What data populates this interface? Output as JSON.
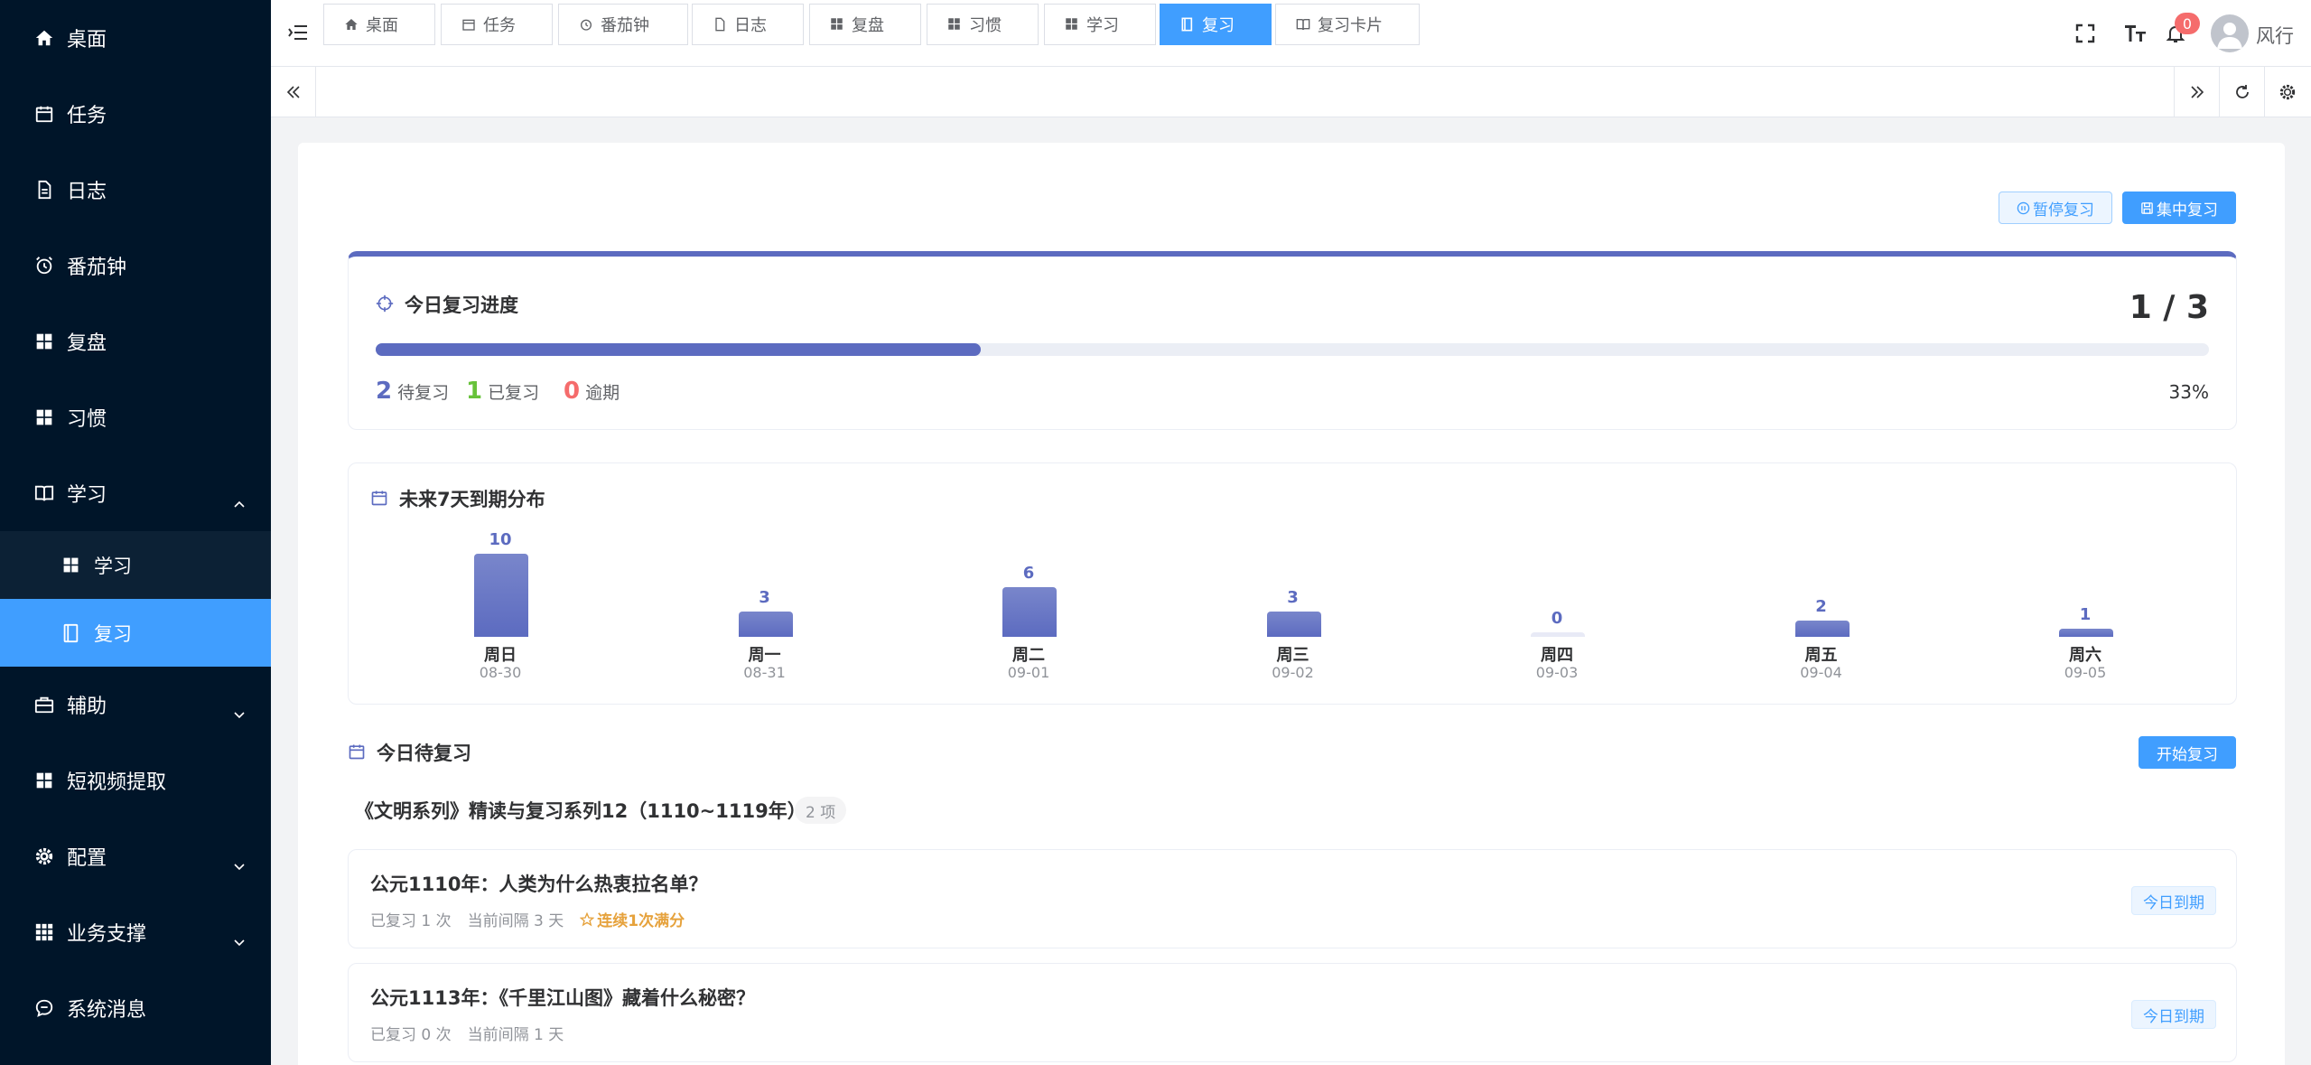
{
  "sidebar": {
    "items": [
      {
        "label": "桌面",
        "icon": "home-icon"
      },
      {
        "label": "任务",
        "icon": "calendar-icon"
      },
      {
        "label": "日志",
        "icon": "document-icon"
      },
      {
        "label": "番茄钟",
        "icon": "alarm-clock-icon"
      },
      {
        "label": "复盘",
        "icon": "grid-icon"
      },
      {
        "label": "习惯",
        "icon": "grid-icon"
      },
      {
        "label": "学习",
        "icon": "book-icon",
        "expanded": true
      },
      {
        "label": "辅助",
        "icon": "toolbox-icon"
      },
      {
        "label": "短视频提取",
        "icon": "grid-icon"
      },
      {
        "label": "配置",
        "icon": "gear-icon"
      },
      {
        "label": "业务支撑",
        "icon": "apps-icon"
      },
      {
        "label": "系统消息",
        "icon": "chat-icon"
      }
    ],
    "sub_items": [
      {
        "label": "学习",
        "icon": "grid-icon"
      },
      {
        "label": "复习",
        "icon": "notebook-icon",
        "active": true
      }
    ]
  },
  "header": {
    "breadcrumb": [
      "学习",
      "/",
      "复习"
    ],
    "notification_count": "0",
    "user_name": "风行"
  },
  "tags": [
    {
      "label": "桌面",
      "icon": "home-icon"
    },
    {
      "label": "任务",
      "icon": "calendar-icon"
    },
    {
      "label": "番茄钟",
      "icon": "alarm-clock-icon"
    },
    {
      "label": "日志",
      "icon": "document-icon"
    },
    {
      "label": "复盘",
      "icon": "grid-icon"
    },
    {
      "label": "习惯",
      "icon": "grid-icon"
    },
    {
      "label": "学习",
      "icon": "grid-icon"
    },
    {
      "label": "复习",
      "icon": "notebook-icon",
      "active": true
    },
    {
      "label": "复习卡片",
      "icon": "book-icon"
    }
  ],
  "toolbar": {
    "pause_label": "暂停复习",
    "focus_label": "集中复习"
  },
  "progress": {
    "title": "今日复习进度",
    "count_text": "1 / 3",
    "fraction": 0.33,
    "pending_num": "2",
    "pending_label": "待复习",
    "done_num": "1",
    "done_label": "已复习",
    "overdue_num": "0",
    "overdue_label": "逾期",
    "percent_text": "33%",
    "colors": {
      "accent": "#5c6bc0",
      "done": "#67c23a",
      "overdue": "#f56c6c"
    }
  },
  "chart_data": {
    "type": "bar",
    "title": "未来7天到期分布",
    "categories": [
      "周日",
      "周一",
      "周二",
      "周三",
      "周四",
      "周五",
      "周六"
    ],
    "dates": [
      "08-30",
      "08-31",
      "09-01",
      "09-02",
      "09-03",
      "09-04",
      "09-05"
    ],
    "values": [
      10,
      3,
      6,
      3,
      0,
      2,
      1
    ],
    "ylim": [
      0,
      10
    ],
    "color": "#5c6bc0"
  },
  "today": {
    "title": "今日待复习",
    "start_label": "开始复习",
    "group_title": "《文明系列》精读与复习系列12（1110~1119年）",
    "group_count": "2 项",
    "items": [
      {
        "title": "公元1110年：人类为什么热衷拉名单？",
        "reviewed": "已复习 1 次",
        "interval": "当前间隔 3 天",
        "streak": "连续1次满分",
        "due": "今日到期"
      },
      {
        "title": "公元1113年：《千里江山图》藏着什么秘密？",
        "reviewed": "已复习 0 次",
        "interval": "当前间隔 1 天",
        "due": "今日到期"
      }
    ]
  }
}
